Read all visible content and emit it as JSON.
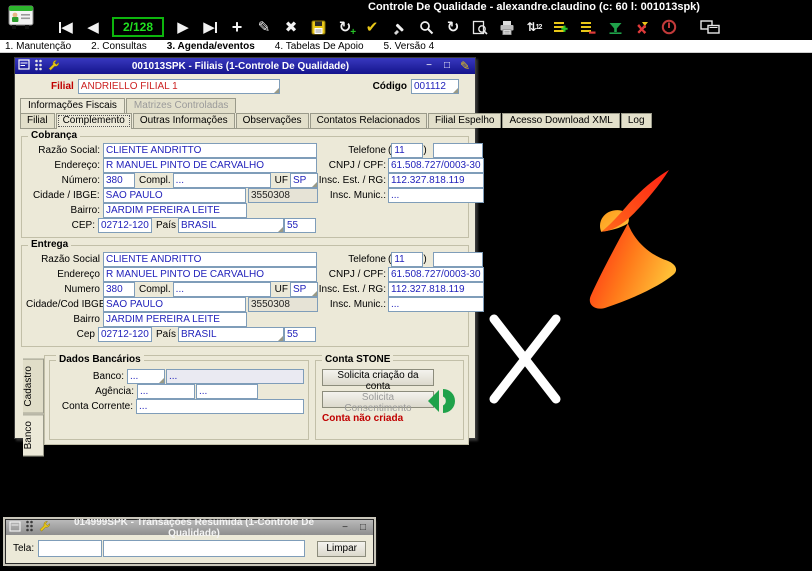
{
  "app": {
    "title": "Controle De Qualidade - alexandre.claudino (c: 60 l: 001013spk)",
    "record_counter": "2/128",
    "toolbar_icons": [
      "first-record",
      "previous-record",
      "next-record",
      "last-record",
      "add",
      "edit",
      "delete",
      "save",
      "save-new",
      "confirm",
      "brush",
      "search",
      "refresh",
      "preview",
      "print",
      "sort",
      "grid-add",
      "grid-remove",
      "filter",
      "filter-clear",
      "exit",
      "windows"
    ]
  },
  "menubar": {
    "items": [
      "1. Manutenção",
      "2. Consultas",
      "3. Agenda/eventos",
      "4. Tabelas De Apoio",
      "5. Versão 4"
    ],
    "active": "3. Agenda/eventos"
  },
  "main_window": {
    "title": "001013SPK - Filiais (1-Controle De Qualidade)",
    "titlebar_icons": [
      "form-icon",
      "grid-handle-icon",
      "wrench-icon"
    ],
    "controls": {
      "minimize": "−",
      "maximize": "□"
    },
    "header": {
      "filial_label": "Filial",
      "filial_value": "ANDRIELLO FILIAL 1",
      "codigo_label": "Código",
      "codigo_value": "001112"
    },
    "tabs_top": {
      "items": [
        "Informações Fiscais",
        "Matrizes Controladas"
      ],
      "active": "Informações Fiscais",
      "disabled": "Matrizes Controladas"
    },
    "tabs_sub": {
      "items": [
        "Filial",
        "Complemento",
        "Outras Informações",
        "Observações",
        "Contatos Relacionados",
        "Filial Espelho",
        "Acesso Download XML",
        "Log"
      ],
      "active": "Complemento"
    },
    "cobranca": {
      "title": "Cobrança",
      "razao_label": "Razão Social:",
      "razao": "CLIENTE ANDRITTO",
      "endereco_label": "Endereço:",
      "endereco": "R MANUEL PINTO DE CARVALHO",
      "numero_label": "Número:",
      "numero": "380",
      "compl_label": "Compl.",
      "compl": "...",
      "uf_label": "UF",
      "uf": "SP",
      "cidade_label": "Cidade / IBGE:",
      "cidade": "SAO PAULO",
      "ibge": "3550308",
      "bairro_label": "Bairro:",
      "bairro": "JARDIM PEREIRA LEITE",
      "cep_label": "CEP:",
      "cep": "02712-120",
      "pais_label": "País",
      "pais": "BRASIL",
      "pais_cod": "55",
      "telefone_label": "Telefone",
      "paren_open": "(",
      "paren_close": ")",
      "ddd": "11",
      "telefone": "",
      "cnpj_label": "CNPJ / CPF:",
      "cnpj": "61.508.727/0003-30",
      "insc_est_label": "Insc. Est. / RG:",
      "insc_est": "112.327.818.119",
      "insc_mun_label": "Insc. Munic.:",
      "insc_mun": "..."
    },
    "entrega": {
      "title": "Entrega",
      "razao_label": "Razão Social",
      "razao": "CLIENTE ANDRITTO",
      "endereco_label": "Endereço",
      "endereco": "R MANUEL PINTO DE CARVALHO",
      "numero_label": "Numero",
      "numero": "380",
      "compl_label": "Compl.",
      "compl": "...",
      "uf_label": "UF",
      "uf": "SP",
      "cidade_label": "Cidade/Cod IBGE",
      "cidade": "SAO PAULO",
      "ibge": "3550308",
      "bairro_label": "Bairro",
      "bairro": "JARDIM PEREIRA LEITE",
      "cep_label": "Cep",
      "cep": "02712-120",
      "pais_label": "País",
      "pais": "BRASIL",
      "pais_cod": "55",
      "telefone_label": "Telefone",
      "paren_open": "(",
      "paren_close": ")",
      "ddd": "11",
      "telefone": "",
      "cnpj_label": "CNPJ / CPF:",
      "cnpj": "61.508.727/0003-30",
      "insc_est_label": "Insc. Est. / RG:",
      "insc_est": "112.327.818.119",
      "insc_mun_label": "Insc. Munic.:",
      "insc_mun": "..."
    },
    "side_tabs": {
      "items": [
        "Cadastro",
        "Banco"
      ],
      "active": "Banco"
    },
    "dados_bancarios": {
      "title": "Dados Bancários",
      "banco_label": "Banco:",
      "banco_cod": "...",
      "banco_nome": "...",
      "agencia_label": "Agência:",
      "agencia_cod": "...",
      "agencia_dv": "...",
      "conta_label": "Conta Corrente:",
      "conta": "..."
    },
    "conta_stone": {
      "title": "Conta STONE",
      "btn_criacao": "Solicita criação da conta",
      "btn_consentimento": "Solicita Consentimento",
      "status": "Conta não criada",
      "status_color": "#c00000",
      "icon": "stone-sync-icon"
    }
  },
  "bottom_window": {
    "title": "014999SPK - Transações Resumida (1-Controle De Qualidade)",
    "titlebar_icons": [
      "form-icon",
      "grid-handle-icon",
      "wrench-icon"
    ],
    "controls": {
      "minimize": "−",
      "maximize": "□"
    },
    "tela_label": "Tela:",
    "tela_value": "",
    "tela_value2": "",
    "limpar_label": "Limpar"
  },
  "colors": {
    "titlebar_active": "#1b1b9e",
    "counter_green": "#0db50d",
    "value_blue": "#2222bb",
    "alert_red": "#c00000",
    "stone_green": "#1fa24a",
    "logo_red": "#ff2e14",
    "logo_orange": "#ff8a1e",
    "logo_yellow": "#ffbe36"
  }
}
